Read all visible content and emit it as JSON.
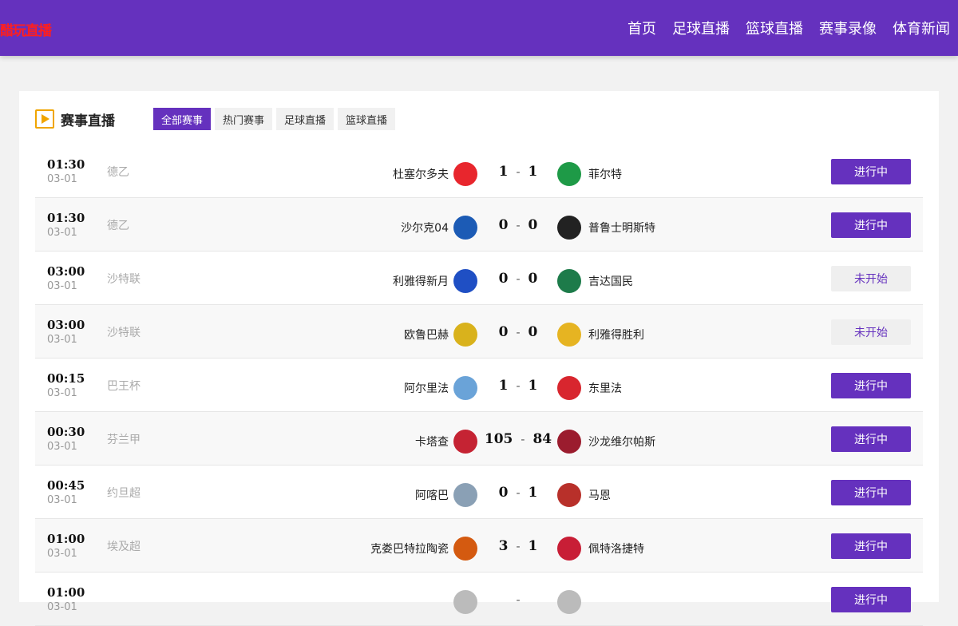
{
  "site": {
    "logo_text": "醋玩直播"
  },
  "nav": [
    "首页",
    "足球直播",
    "篮球直播",
    "赛事录像",
    "体育新闻"
  ],
  "panel": {
    "title": "赛事直播",
    "tabs": [
      {
        "label": "全部赛事",
        "active": true
      },
      {
        "label": "热门赛事",
        "active": false
      },
      {
        "label": "足球直播",
        "active": false
      },
      {
        "label": "篮球直播",
        "active": false
      }
    ]
  },
  "colors": {
    "brand": "#6531be",
    "logo": "#ff1e1e"
  },
  "matches": [
    {
      "time": "01:30",
      "date": "03-01",
      "league": "德乙",
      "home": "杜塞尔多夫",
      "home_score": "1",
      "away_score": "1",
      "away": "菲尔特",
      "status": "进行中",
      "live": true,
      "home_icon": "fortuna-crest-icon",
      "away_icon": "clover-crest-icon"
    },
    {
      "time": "01:30",
      "date": "03-01",
      "league": "德乙",
      "home": "沙尔克04",
      "home_score": "0",
      "away_score": "0",
      "away": "普鲁士明斯特",
      "status": "进行中",
      "live": true,
      "home_icon": "schalke-crest-icon",
      "away_icon": "eagle-crest-icon"
    },
    {
      "time": "03:00",
      "date": "03-01",
      "league": "沙特联",
      "home": "利雅得新月",
      "home_score": "0",
      "away_score": "0",
      "away": "吉达国民",
      "status": "未开始",
      "live": false,
      "home_icon": "hilal-crest-icon",
      "away_icon": "ahli-crest-icon"
    },
    {
      "time": "03:00",
      "date": "03-01",
      "league": "沙特联",
      "home": "欧鲁巴赫",
      "home_score": "0",
      "away_score": "0",
      "away": "利雅得胜利",
      "status": "未开始",
      "live": false,
      "home_icon": "okhdood-crest-icon",
      "away_icon": "nassr-crest-icon"
    },
    {
      "time": "00:15",
      "date": "03-01",
      "league": "巴王杯",
      "home": "阿尔里法",
      "home_score": "1",
      "away_score": "1",
      "away": "东里法",
      "status": "进行中",
      "live": true,
      "home_icon": "riffa-crest-icon",
      "away_icon": "east-riffa-crest-icon"
    },
    {
      "time": "00:30",
      "date": "03-01",
      "league": "芬兰甲",
      "home": "卡塔查",
      "home_score": "105",
      "away_score": "84",
      "away": "沙龙维尔帕斯",
      "status": "进行中",
      "live": true,
      "home_icon": "kataja-crest-icon",
      "away_icon": "vilpas-crest-icon"
    },
    {
      "time": "00:45",
      "date": "03-01",
      "league": "约旦超",
      "home": "阿喀巴",
      "home_score": "0",
      "away_score": "1",
      "away": "马恩",
      "status": "进行中",
      "live": true,
      "home_icon": "aqaba-crest-icon",
      "away_icon": "maan-crest-icon"
    },
    {
      "time": "01:00",
      "date": "03-01",
      "league": "埃及超",
      "home": "克娄巴特拉陶瓷",
      "home_score": "3",
      "away_score": "1",
      "away": "佩特洛捷特",
      "status": "进行中",
      "live": true,
      "home_icon": "ceramica-crest-icon",
      "away_icon": "petrojet-crest-icon"
    },
    {
      "time": "01:00",
      "date": "03-01",
      "league": "",
      "home": "",
      "home_score": "",
      "away_score": "",
      "away": "",
      "status": "进行中",
      "live": true,
      "home_icon": "team-crest-icon",
      "away_icon": "team-crest-icon"
    }
  ]
}
